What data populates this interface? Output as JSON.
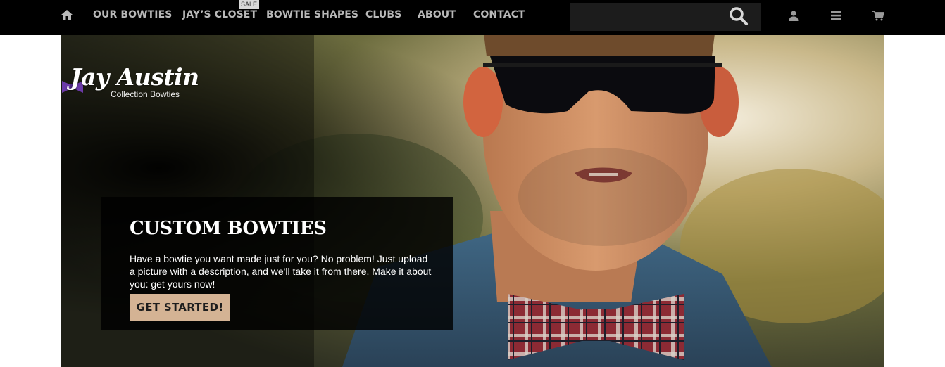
{
  "nav": {
    "home_icon": "home-icon",
    "items": [
      {
        "label": "OUR BOWTIES"
      },
      {
        "label": "JAY’S CLOSET",
        "badge": "SALE"
      },
      {
        "label": "BOWTIE SHAPES"
      },
      {
        "label": "CLUBS"
      },
      {
        "label": "ABOUT"
      },
      {
        "label": "CONTACT"
      }
    ],
    "search": {
      "placeholder": "",
      "value": "",
      "icon": "search-icon"
    },
    "utility_icons": [
      "user-icon",
      "menu-icon",
      "cart-icon"
    ]
  },
  "logo": {
    "script": "Jay Austin",
    "subtitle": "Collection Bowties"
  },
  "hero": {
    "title": "CUSTOM BOWTIES",
    "body": "Have a bowtie you want made just for you? No problem! Just upload a picture with a description, and we'll take it from there. Make it about you: get yours now!",
    "cta_label": "GET STARTED!"
  },
  "colors": {
    "topbar_bg": "#000000",
    "nav_text": "#b8b8b8",
    "cta_bg": "#d4b394",
    "promo_bg": "#000000"
  }
}
